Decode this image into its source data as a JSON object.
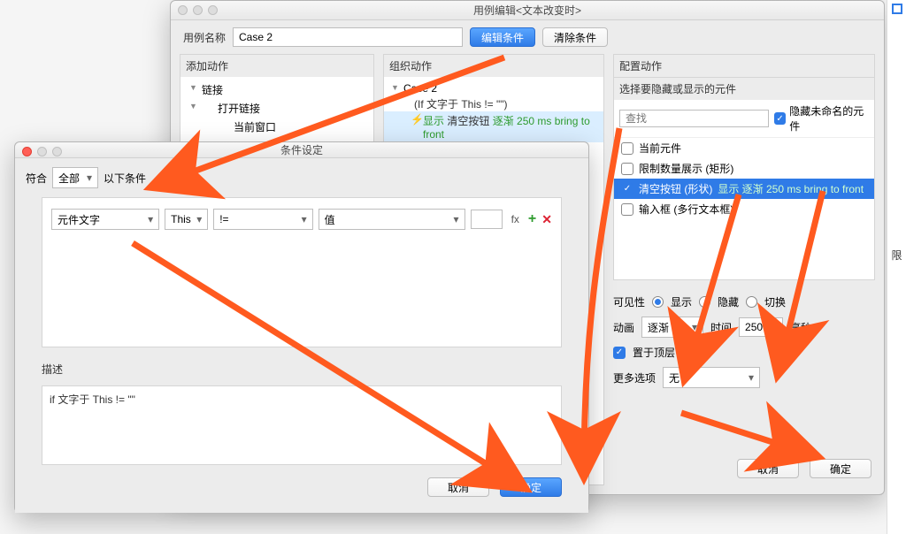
{
  "editor": {
    "title": "用例编辑<文本改变时>",
    "case_name_label": "用例名称",
    "case_name_value": "Case 2",
    "edit_condition_btn": "编辑条件",
    "clear_condition_btn": "清除条件",
    "columns": {
      "add_action": "添加动作",
      "organize_action": "组织动作",
      "configure_action": "配置动作"
    },
    "tree": {
      "links": "链接",
      "open_link": "打开链接",
      "current_window": "当前窗口"
    },
    "case": {
      "name": "Case 2",
      "cond": "(If 文字于 This != \"\")",
      "action_prefix": "显示 ",
      "action_target": "清空按钮",
      "action_suffix": " 逐渐 250 ms bring to front"
    },
    "config": {
      "select_label": "选择要隐藏或显示的元件",
      "search_placeholder": "查找",
      "hide_unnamed": "隐藏未命名的元件",
      "components": [
        {
          "label": "当前元件",
          "checked": false,
          "selected": false
        },
        {
          "label": "限制数量展示 (矩形)",
          "checked": false,
          "selected": false
        },
        {
          "label": "清空按钮 (形状)",
          "suffix": "显示 逐渐 250 ms bring to front",
          "checked": true,
          "selected": true
        },
        {
          "label": "输入框 (多行文本框)",
          "checked": false,
          "selected": false
        }
      ],
      "visibility_label": "可见性",
      "vis_show": "显示",
      "vis_hide": "隐藏",
      "vis_toggle": "切换",
      "anim_label": "动画",
      "anim_value": "逐渐",
      "time_label": "时间",
      "time_value": "250",
      "time_unit": "毫秒",
      "bring_front": "置于顶层",
      "more_options": "更多选项",
      "more_value": "无",
      "cancel": "取消",
      "ok": "确定"
    }
  },
  "condition": {
    "title": "条件设定",
    "match_label": "符合",
    "match_value": "全部",
    "following": "以下条件",
    "row": {
      "subject": "元件文字",
      "target": "This",
      "op": "!=",
      "type": "值",
      "value": ""
    },
    "fx": "fx",
    "desc_label": "描述",
    "desc_text": "if 文字于 This != \"\"",
    "cancel": "取消",
    "ok": "确定"
  },
  "right_strip": {
    "label": "限"
  }
}
